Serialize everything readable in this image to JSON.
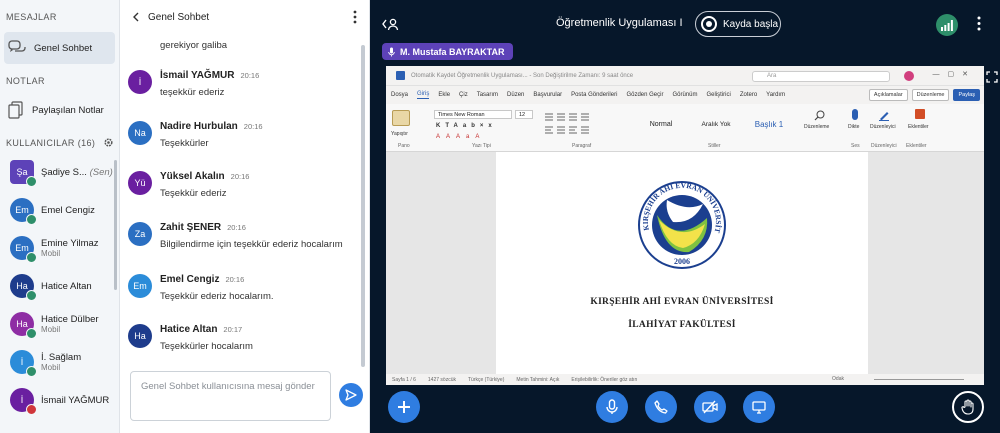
{
  "sidebar": {
    "messages_title": "MESAJLAR",
    "public_chat_label": "Genel Sohbet",
    "notes_title": "NOTLAR",
    "shared_notes_label": "Paylaşılan Notlar",
    "users_title": "KULLANICILAR (16)",
    "users": [
      {
        "initials": "Şa",
        "name": "Şadiye S...",
        "you": "(Sen)",
        "sub": "",
        "color": "#5d42b8",
        "shape": "square",
        "status": "green"
      },
      {
        "initials": "Em",
        "name": "Emel Cengiz",
        "sub": "",
        "color": "#2b6fc2",
        "shape": "circle",
        "status": "green"
      },
      {
        "initials": "Em",
        "name": "Emine Yilmaz",
        "sub": "Mobil",
        "color": "#2b6fc2",
        "shape": "circle",
        "status": "green"
      },
      {
        "initials": "Ha",
        "name": "Hatice Altan",
        "sub": "",
        "color": "#1e3c8c",
        "shape": "circle",
        "status": "green"
      },
      {
        "initials": "Ha",
        "name": "Hatice Dülber",
        "sub": "Mobil",
        "color": "#8e2da4",
        "shape": "circle",
        "status": "green"
      },
      {
        "initials": "İ",
        "name": "İ. Sağlam",
        "sub": "Mobil",
        "color": "#2b8cd9",
        "shape": "circle",
        "status": "green"
      },
      {
        "initials": "İ",
        "name": "İsmail YAĞMUR",
        "sub": "",
        "color": "#6a1fa0",
        "shape": "circle",
        "status": "red"
      }
    ]
  },
  "chat": {
    "title": "Genel Sohbet",
    "partial_text": "gerekiyor galiba",
    "messages": [
      {
        "initials": "İ",
        "name": "İsmail YAĞMUR",
        "time": "20:16",
        "text": "teşekkür ederiz",
        "color": "#6a1fa0"
      },
      {
        "initials": "Na",
        "name": "Nadire Hurbulan",
        "time": "20:16",
        "text": "Teşekkürler",
        "color": "#2b6fc2"
      },
      {
        "initials": "Yü",
        "name": "Yüksel Akalın",
        "time": "20:16",
        "text": "Teşekkür ederiz",
        "color": "#6a1fa0"
      },
      {
        "initials": "Za",
        "name": "Zahit ŞENER",
        "time": "20:16",
        "text": "Bilgilendirme için teşekkür ederiz hocalarım",
        "color": "#2b6fc2"
      },
      {
        "initials": "Em",
        "name": "Emel Cengiz",
        "time": "20:16",
        "text": "Teşekkür ederiz hocalarım.",
        "color": "#2b8cd9"
      },
      {
        "initials": "Ha",
        "name": "Hatice Altan",
        "time": "20:17",
        "text": "Teşekkürler hocalarım",
        "color": "#1e3c8c"
      }
    ],
    "input_placeholder": "Genel Sohbet kullanıcısına mesaj gönder"
  },
  "main": {
    "title": "Öğretmenlik Uygulaması I",
    "record_label": "Kayda başla",
    "presenter": "M. Mustafa BAYRAKTAR"
  },
  "word": {
    "title_text": "Otomatik Kaydet   Öğretmenlik Uygulaması... - Son Değiştirilme Zamanı: 9 saat önce",
    "search_placeholder": "Ara",
    "menu": [
      "Dosya",
      "Giriş",
      "Ekle",
      "Çiz",
      "Tasarım",
      "Düzen",
      "Başvurular",
      "Posta Gönderileri",
      "Gözden Geçir",
      "Görünüm",
      "Geliştirici",
      "Zotero",
      "Yardım"
    ],
    "menu_right": [
      "Açıklamalar",
      "Düzenleme",
      "Paylaş"
    ],
    "font_name": "Times New Roman",
    "font_size": "12",
    "styles": [
      "Normal",
      "Aralık Yok",
      "Başlık 1"
    ],
    "groups": [
      "Pano",
      "Yazı Tipi",
      "Paragraf",
      "Stiller",
      "Ses",
      "Düzenleyici",
      "Eklentiler"
    ],
    "ribbon_buttons": [
      "Yapıştır",
      "Düzenleme",
      "Dikte",
      "Düzenleyici",
      "Eklentiler"
    ],
    "seal_text": "KIRŞEHİR AHİ EVRAN ÜNİVERSİTESİ",
    "seal_year": "2006",
    "doc_line1": "KIRŞEHİR AHİ EVRAN ÜNİVERSİTESİ",
    "doc_line2": "İLAHİYAT FAKÜLTESİ",
    "status": [
      "Sayfa 1 / 6",
      "1427 sözcük",
      "Türkçe (Türkiye)",
      "Metin Tahmini: Açık",
      "Erişilebilirlik: Öneriler göz atın"
    ],
    "status_right": "Odak"
  },
  "colors": {
    "accent": "#2f7de1",
    "presenter_bg": "#5d42b8",
    "status_green": "#2e8f6a",
    "main_bg": "#06172a"
  }
}
